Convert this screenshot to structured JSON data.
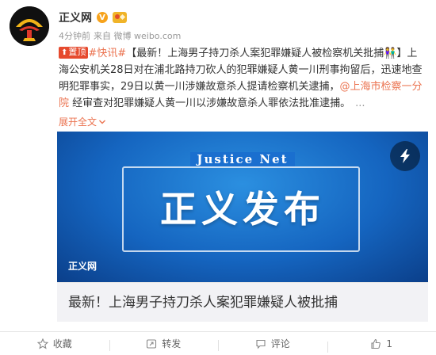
{
  "author": {
    "name": "正义网",
    "verified_icon": "v-badge-icon",
    "vip_icon": "gold-badge-icon"
  },
  "meta": {
    "time": "4分钟前",
    "source": "来自 微博 weibo.com"
  },
  "post": {
    "top_tag": "置顶",
    "hashtag": "#快讯#",
    "line1": "【最新！上海男子持刀杀人案犯罪嫌疑人被检察机关批捕👫】上",
    "line2": "海公安机关28日对在浦北路持刀砍人的犯罪嫌疑人黄一川刑事拘留后，迅速地查",
    "line3": "明犯罪事实，29日以黄一川涉嫌故意杀人提请检察机关逮捕，",
    "mention1": "@上海市检察一分",
    "mention2": "院",
    "line4_rest": "经审查对犯罪嫌疑人黄一川以涉嫌故意杀人罪依法批准逮捕。",
    "ellipsis": "...",
    "expand": "展开全文",
    "link_color": "#eb7350"
  },
  "card": {
    "brand_en": "Justice Net",
    "headline_big": "正义发布",
    "watermark": "正义网",
    "caption": "最新！上海男子持刀杀人案犯罪嫌疑人被批捕"
  },
  "actions": {
    "favorite": "收藏",
    "repost": "转发",
    "comment": "评论",
    "like_count": "1"
  }
}
